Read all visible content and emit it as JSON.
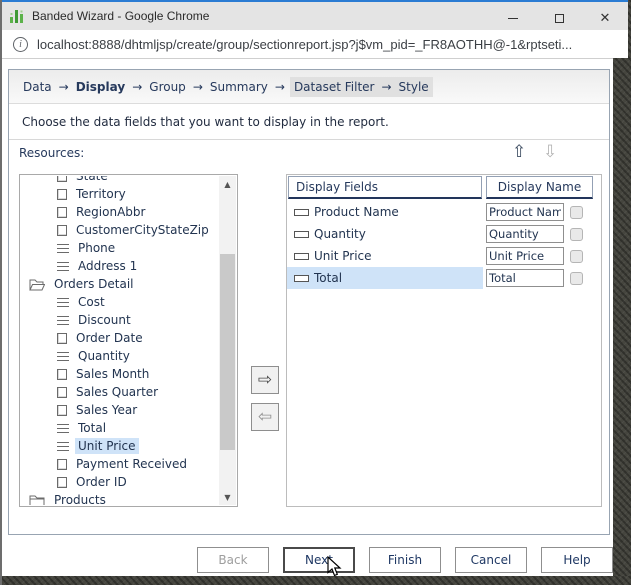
{
  "window": {
    "title": "Banded Wizard - Google Chrome",
    "app_icon": "green-bar-chart-icon",
    "controls": {
      "close": "✕"
    }
  },
  "browser": {
    "url": "localhost:8888/dhtmljsp/create/group/sectionreport.jsp?j$vm_pid=_FR8AOTHH@-1&rptseti..."
  },
  "wizard": {
    "step_arrow": "→",
    "steps": [
      {
        "label": "Data",
        "state": "normal"
      },
      {
        "label": "Display",
        "state": "current"
      },
      {
        "label": "Group",
        "state": "normal"
      },
      {
        "label": "Summary",
        "state": "normal"
      },
      {
        "label": "Dataset Filter",
        "state": "pending"
      },
      {
        "label": "Style",
        "state": "pending"
      }
    ],
    "message": "Choose the data fields that you want to display in the report.",
    "resources_label": "Resources:",
    "reorder": {
      "up": "⇧",
      "down": "⇩"
    },
    "scrollbar": {
      "up": "▲",
      "down": "▼"
    },
    "transfer": {
      "add": "⇨",
      "remove": "⇦"
    },
    "tree": {
      "items": [
        {
          "label": "State",
          "icon": "column",
          "level": 2,
          "clipped": true
        },
        {
          "label": "Territory",
          "icon": "column",
          "level": 2
        },
        {
          "label": "RegionAbbr",
          "icon": "column",
          "level": 2
        },
        {
          "label": "CustomerCityStateZip",
          "icon": "column",
          "level": 2
        },
        {
          "label": "Phone",
          "icon": "formula",
          "level": 2
        },
        {
          "label": "Address 1",
          "icon": "formula",
          "level": 2
        },
        {
          "label": "Orders Detail",
          "icon": "folder-open",
          "level": 1
        },
        {
          "label": "Cost",
          "icon": "formula",
          "level": 2
        },
        {
          "label": "Discount",
          "icon": "formula",
          "level": 2
        },
        {
          "label": "Order Date",
          "icon": "column",
          "level": 2
        },
        {
          "label": "Quantity",
          "icon": "formula",
          "level": 2
        },
        {
          "label": "Sales Month",
          "icon": "column",
          "level": 2
        },
        {
          "label": "Sales Quarter",
          "icon": "column",
          "level": 2
        },
        {
          "label": "Sales Year",
          "icon": "column",
          "level": 2
        },
        {
          "label": "Total",
          "icon": "formula",
          "level": 2
        },
        {
          "label": "Unit Price",
          "icon": "formula",
          "level": 2,
          "selected": true
        },
        {
          "label": "Payment Received",
          "icon": "column",
          "level": 2
        },
        {
          "label": "Order ID",
          "icon": "column",
          "level": 2
        },
        {
          "label": "Products",
          "icon": "folder-closed",
          "level": 1
        }
      ]
    },
    "table": {
      "headers": {
        "fields": "Display Fields",
        "name": "Display Name"
      },
      "rows": [
        {
          "field": "Product Name",
          "display_name": "Product Name",
          "checked": false,
          "selected": false
        },
        {
          "field": "Quantity",
          "display_name": "Quantity",
          "checked": false,
          "selected": false
        },
        {
          "field": "Unit Price",
          "display_name": "Unit Price",
          "checked": false,
          "selected": false
        },
        {
          "field": "Total",
          "display_name": "Total",
          "checked": false,
          "selected": true
        }
      ]
    },
    "buttons": [
      {
        "label": "Back",
        "disabled": true
      },
      {
        "label": "Next",
        "focused": true
      },
      {
        "label": "Finish"
      },
      {
        "label": "Cancel"
      },
      {
        "label": "Help"
      }
    ],
    "colors": {
      "selection": "#cfe3f8",
      "accent_text": "#1f3864",
      "titlebar_accent": "#2b7cd3",
      "desktop": "#45453e"
    }
  }
}
